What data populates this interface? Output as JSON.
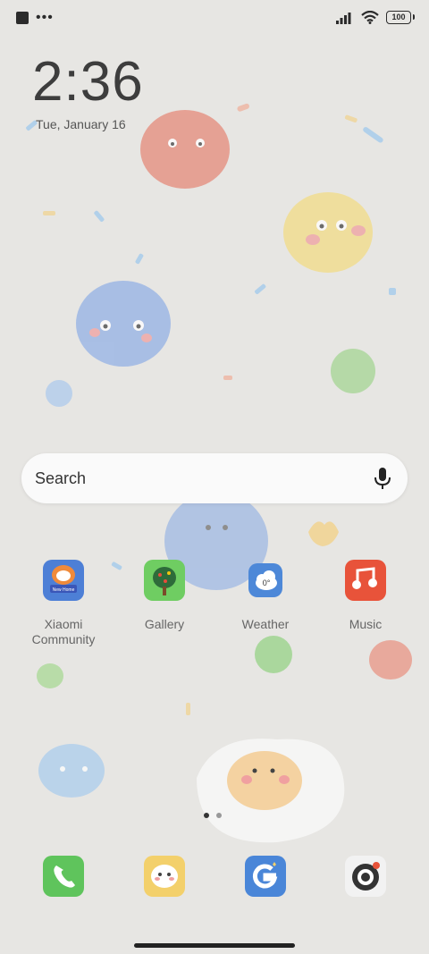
{
  "status_bar": {
    "left_icons": [
      "app-square-icon",
      "more-dots-icon"
    ],
    "right_icons": [
      "signal-icon",
      "wifi-icon",
      "battery-icon"
    ],
    "battery": "100"
  },
  "lock_clock": {
    "time": "2:36",
    "date": "Tue, January 16"
  },
  "search": {
    "placeholder": "Search",
    "icon": "mic-icon"
  },
  "apps": [
    {
      "label": "Xiaomi Community",
      "icon": "xiaomi-community-icon",
      "badge_text": "New Home",
      "color": "#4d7fd6"
    },
    {
      "label": "Gallery",
      "icon": "gallery-icon",
      "color": "#6fcd62"
    },
    {
      "label": "Weather",
      "icon": "weather-icon",
      "temp": "0°",
      "color": "#4d88d8"
    },
    {
      "label": "Music",
      "icon": "music-icon",
      "color": "#e8533a"
    }
  ],
  "page_indicator": {
    "pages": 2,
    "active": 1
  },
  "dock": [
    {
      "name": "phone",
      "icon": "phone-icon",
      "color": "#5fc45c"
    },
    {
      "name": "messages",
      "icon": "messages-icon",
      "color": "#f3d06b"
    },
    {
      "name": "google",
      "icon": "google-icon",
      "color": "#4a86d8"
    },
    {
      "name": "camera",
      "icon": "camera-icon",
      "color": "#f2f2f2"
    }
  ],
  "colors": {
    "background": "#e7e6e3",
    "search_bg": "#fafafa"
  }
}
